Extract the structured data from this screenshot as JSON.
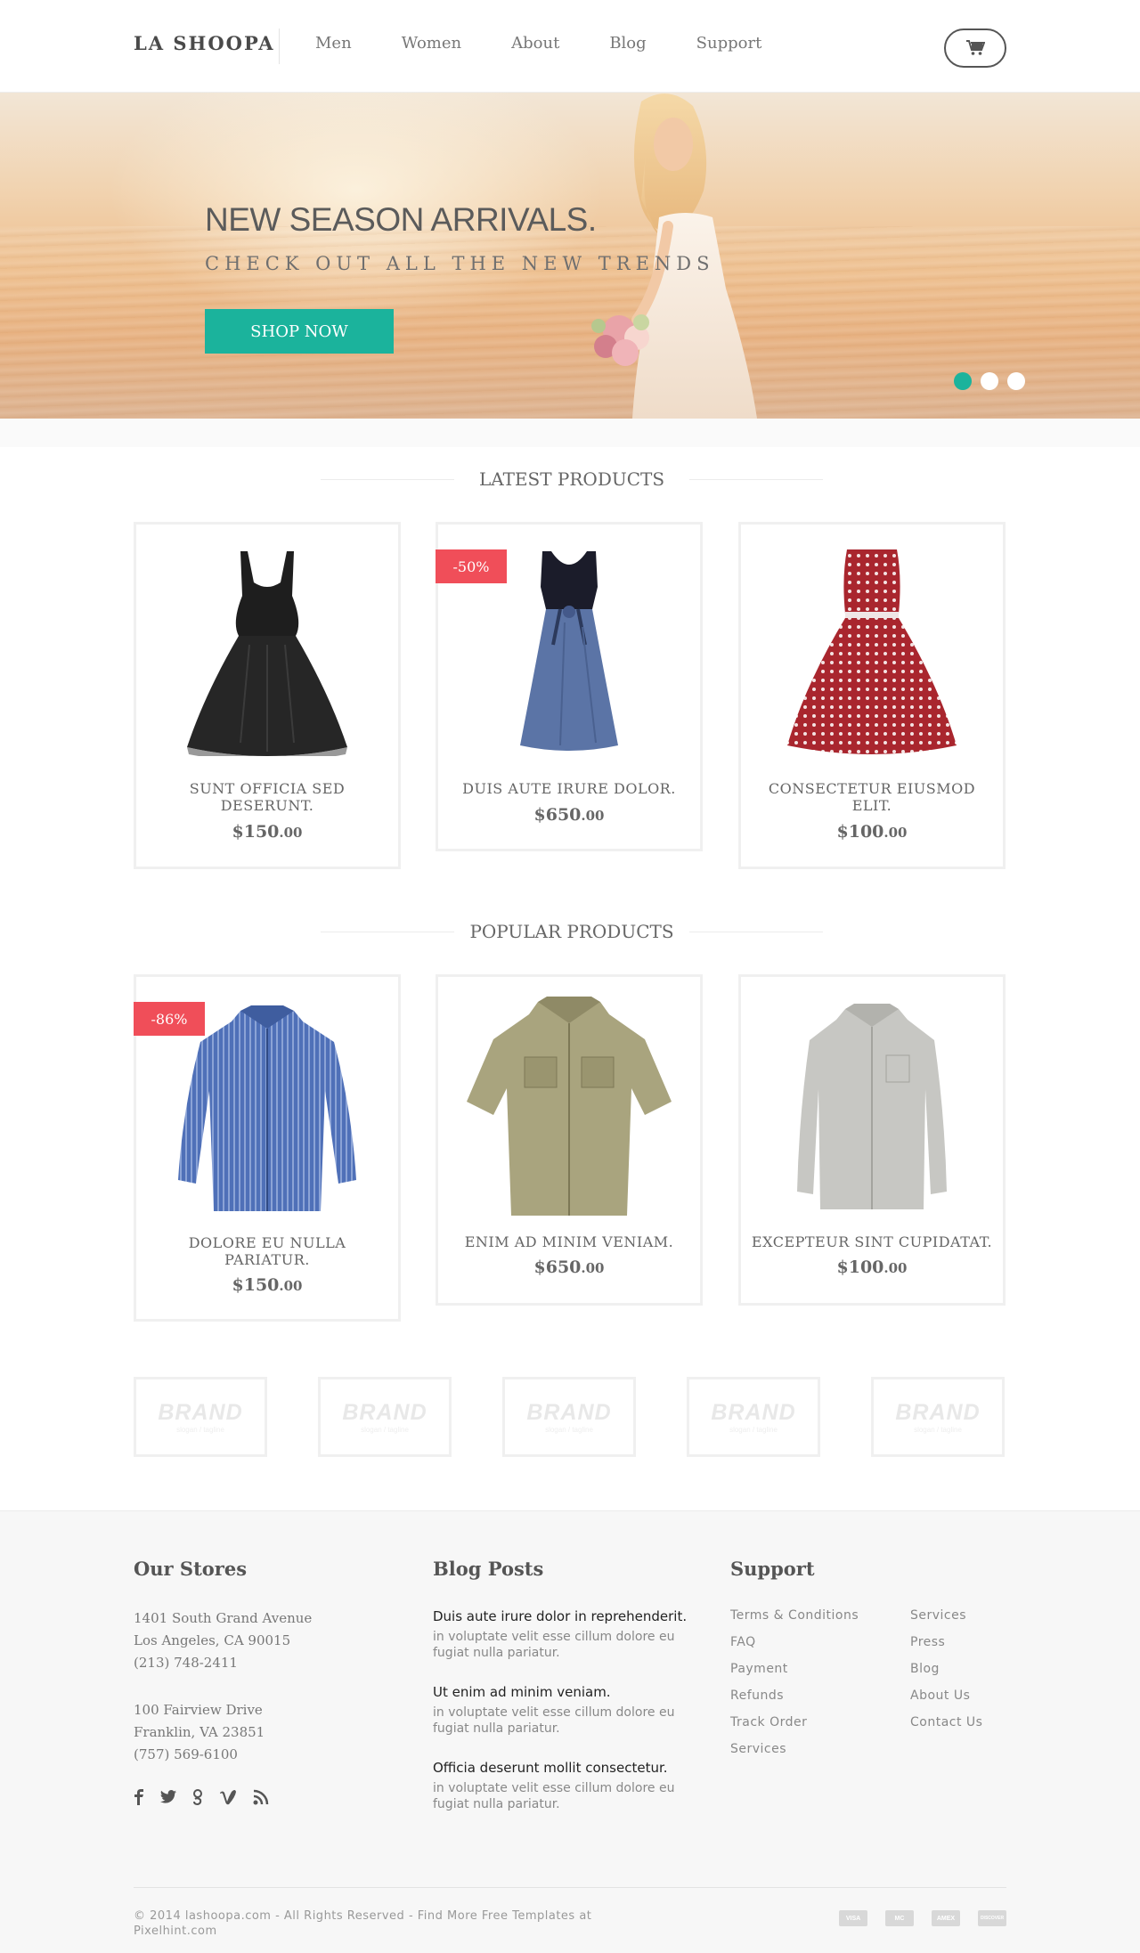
{
  "header": {
    "logo": "LA SHOOPA",
    "nav": [
      "Men",
      "Women",
      "About",
      "Blog",
      "Support"
    ]
  },
  "hero": {
    "title": "NEW SEASON ARRIVALS.",
    "subtitle": "CHECK OUT ALL THE NEW TRENDS",
    "cta": "SHOP NOW",
    "slides": 3,
    "active_slide": 1
  },
  "latest": {
    "title": "LATEST PRODUCTS",
    "products": [
      {
        "name": "SUNT OFFICIA SED DESERUNT.",
        "price": "$150",
        "cents": ".00",
        "badge": ""
      },
      {
        "name": "DUIS AUTE IRURE DOLOR.",
        "price": "$650",
        "cents": ".00",
        "badge": "-50%"
      },
      {
        "name": "CONSECTETUR EIUSMOD ELIT.",
        "price": "$100",
        "cents": ".00",
        "badge": ""
      }
    ]
  },
  "popular": {
    "title": "POPULAR PRODUCTS",
    "products": [
      {
        "name": "DOLORE EU NULLA PARIATUR.",
        "price": "$150",
        "cents": ".00",
        "badge": "-86%"
      },
      {
        "name": "ENIM AD MINIM VENIAM.",
        "price": "$650",
        "cents": ".00",
        "badge": ""
      },
      {
        "name": "EXCEPTEUR SINT CUPIDATAT.",
        "price": "$100",
        "cents": ".00",
        "badge": ""
      }
    ]
  },
  "brands": [
    {
      "name": "BRAND",
      "tag": "slogan / tagline"
    },
    {
      "name": "BRAND",
      "tag": "slogan / tagline"
    },
    {
      "name": "BRAND",
      "tag": "slogan / tagline"
    },
    {
      "name": "BRAND",
      "tag": "slogan / tagline"
    },
    {
      "name": "BRAND",
      "tag": "slogan / tagline"
    }
  ],
  "footer": {
    "stores_title": "Our Stores",
    "stores": [
      {
        "line1": "1401 South Grand Avenue",
        "line2": "Los Angeles, CA 90015",
        "phone": "(213) 748-2411"
      },
      {
        "line1": "100 Fairview Drive",
        "line2": "Franklin, VA 23851",
        "phone": "(757) 569-6100"
      }
    ],
    "social_icons": [
      "facebook-icon",
      "twitter-icon",
      "google-icon",
      "vimeo-icon",
      "rss-icon"
    ],
    "blog_title": "Blog Posts",
    "posts": [
      {
        "title": "Duis aute irure dolor in reprehenderit.",
        "excerpt": "in voluptate velit esse cillum dolore eu fugiat nulla pariatur."
      },
      {
        "title": "Ut enim ad minim veniam.",
        "excerpt": "in voluptate velit esse cillum dolore eu fugiat nulla pariatur."
      },
      {
        "title": "Officia deserunt mollit consectetur.",
        "excerpt": "in voluptate velit esse cillum dolore eu fugiat nulla pariatur."
      }
    ],
    "support_title": "Support",
    "support_col1": [
      "Terms & Conditions",
      "FAQ",
      "Payment",
      "Refunds",
      "Track Order",
      "Services"
    ],
    "support_col2": [
      "Services",
      "Press",
      "Blog",
      "About Us",
      "Contact Us"
    ],
    "copyright": "© 2014 lashoopa.com - All Rights Reserved - Find More Free Templates at Pixelhint.com",
    "payments": [
      "VISA",
      "MC",
      "AMEX",
      "DISCOVER"
    ]
  },
  "colors": {
    "accent": "#1bb39c",
    "badge": "#f04e59"
  }
}
